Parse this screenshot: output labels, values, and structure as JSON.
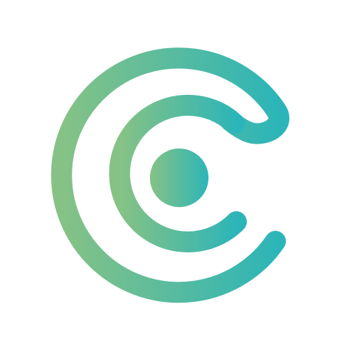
{
  "logo": {
    "icon": "concentric-c-logo-icon",
    "gradient": {
      "start_color": "#86C285",
      "end_color": "#2CB5B8"
    },
    "background_color": "#FFFFFF"
  }
}
